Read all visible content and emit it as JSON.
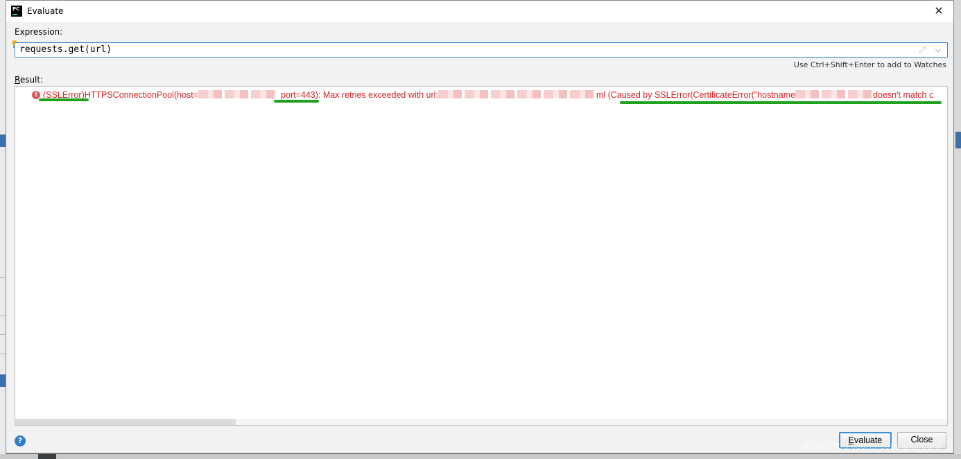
{
  "window": {
    "title": "Evaluate",
    "app_icon_text": "PC",
    "close_glyph": "✕"
  },
  "expression": {
    "label": "Expression:",
    "value": "requests.get(url)",
    "hint": "Use Ctrl+Shift+Enter to add to Watches"
  },
  "result": {
    "label_mnemonic": "R",
    "label_rest": "esult:",
    "error_parts": [
      "(SSLError)HTTPSConnectionPool(host=",
      "port=443): Max retries exceeded with url:",
      "ml (Caused by SSLError(CertificateError(\"hostname",
      "doesn't match c"
    ]
  },
  "buttons": {
    "evaluate_mnemonic": "E",
    "evaluate_rest": "valuate",
    "close": "Close"
  },
  "help_glyph": "?",
  "watermark": "https://blog.csdn.net/ningjuyuanli",
  "colors": {
    "error_text": "#d32222",
    "focus_border": "#3b8ed3",
    "annotation_underline": "#1fa31f"
  },
  "icons": [
    "pycharm-app-icon",
    "close-icon",
    "lightbulb-icon",
    "expand-icon",
    "dropdown-icon",
    "error-icon",
    "help-icon"
  ]
}
